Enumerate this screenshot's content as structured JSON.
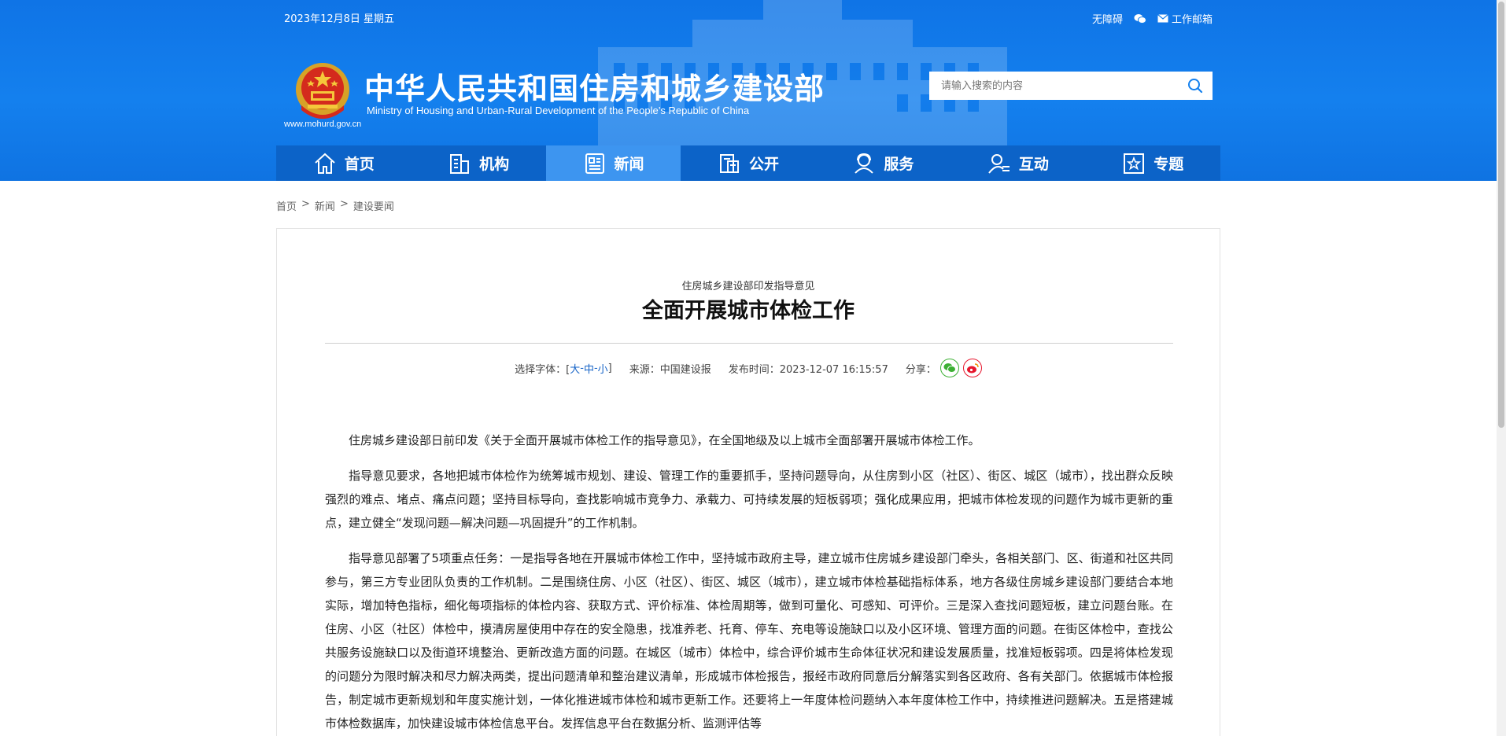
{
  "header": {
    "date": "2023年12月8日 星期五",
    "links": {
      "accessibility": "无障碍",
      "email": "工作邮箱"
    },
    "site_title_cn": "中华人民共和国住房和城乡建设部",
    "site_title_en": "Ministry of Housing and Urban-Rural Development of the People’s Republic of China",
    "domain": "www.mohurd.gov.cn",
    "search_placeholder": "请输入搜索的内容"
  },
  "nav": {
    "items": [
      {
        "label": "首页",
        "icon": "home-icon"
      },
      {
        "label": "机构",
        "icon": "building-icon"
      },
      {
        "label": "新闻",
        "icon": "newspaper-icon"
      },
      {
        "label": "公开",
        "icon": "document-icon"
      },
      {
        "label": "服务",
        "icon": "service-icon"
      },
      {
        "label": "互动",
        "icon": "interact-icon"
      },
      {
        "label": "专题",
        "icon": "star-icon"
      }
    ],
    "active": "新闻"
  },
  "breadcrumb": [
    "首页",
    "新闻",
    "建设要闻"
  ],
  "breadcrumb_sep": ">",
  "article": {
    "subtitle": "住房城乡建设部印发指导意见",
    "title": "全面开展城市体检工作",
    "meta": {
      "font_label": "选择字体：[",
      "font_close": "]",
      "font_large": "大",
      "font_medium": "中",
      "font_small": "小",
      "font_dash": "-",
      "source": "来源：中国建设报",
      "published": "发布时间：2023-12-07 16:15:57",
      "share": "分享："
    },
    "paragraphs": [
      "住房城乡建设部日前印发《关于全面开展城市体检工作的指导意见》，在全国地级及以上城市全面部署开展城市体检工作。",
      "指导意见要求，各地把城市体检作为统筹城市规划、建设、管理工作的重要抓手，坚持问题导向，从住房到小区（社区）、街区、城区（城市），找出群众反映强烈的难点、堵点、痛点问题；坚持目标导向，查找影响城市竞争力、承载力、可持续发展的短板弱项；强化成果应用，把城市体检发现的问题作为城市更新的重点，建立健全“发现问题—解决问题—巩固提升”的工作机制。",
      "指导意见部署了5项重点任务：一是指导各地在开展城市体检工作中，坚持城市政府主导，建立城市住房城乡建设部门牵头，各相关部门、区、街道和社区共同参与，第三方专业团队负责的工作机制。二是围绕住房、小区（社区）、街区、城区（城市），建立城市体检基础指标体系，地方各级住房城乡建设部门要结合本地实际，增加特色指标，细化每项指标的体检内容、获取方式、评价标准、体检周期等，做到可量化、可感知、可评价。三是深入查找问题短板，建立问题台账。在住房、小区（社区）体检中，摸清房屋使用中存在的安全隐患，找准养老、托育、停车、充电等设施缺口以及小区环境、管理方面的问题。在街区体检中，查找公共服务设施缺口以及街道环境整治、更新改造方面的问题。在城区（城市）体检中，综合评价城市生命体征状况和建设发展质量，找准短板弱项。四是将体检发现的问题分为限时解决和尽力解决两类，提出问题清单和整治建议清单，形成城市体检报告，报经市政府同意后分解落实到各区政府、各有关部门。依据城市体检报告，制定城市更新规划和年度实施计划，一体化推进城市体检和城市更新工作。还要将上一年度体检问题纳入本年度体检工作中，持续推进问题解决。五是搭建城市体检数据库，加快建设城市体检信息平台。发挥信息平台在数据分析、监测评估等"
    ]
  },
  "colors": {
    "header_blue": "#1480ee",
    "nav_blue": "#0c63c8",
    "nav_active": "#3d95f0",
    "link_blue": "#1563c7",
    "wechat_green": "#3cb034",
    "weibo_red": "#e6162d"
  }
}
